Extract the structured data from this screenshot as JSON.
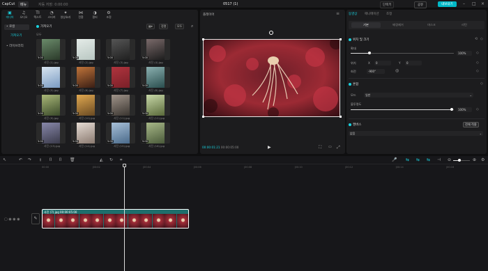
{
  "titlebar": {
    "app_name": "CapCut",
    "menu_label": "메뉴",
    "autosave": "자동 저장: 0:00:00",
    "title": "0517 (1)",
    "shortcut": "단축키",
    "share": "공유",
    "export": "내보내기"
  },
  "media": {
    "tabs": [
      "미디어",
      "오디오",
      "텍스트",
      "스티커",
      "영상효과",
      "전환",
      "필터",
      "조정"
    ],
    "sidebar": {
      "local": "• 로컬",
      "import": "가져오기",
      "library": "• 라이브러리"
    },
    "import_label": "가져오기",
    "all_label": "모두",
    "sort_label": "정렬",
    "filter_label": "모두",
    "files": [
      {
        "badge": "5:00",
        "name": "사진 (1).jpg"
      },
      {
        "badge": "5:00",
        "name": "사진 (2).jpg"
      },
      {
        "badge": "5:00",
        "name": "사진 (3).jpg"
      },
      {
        "badge": "5:00",
        "name": "사진 (4).jpg"
      },
      {
        "badge": "5:00",
        "name": "사진 (5).jpg"
      },
      {
        "badge": "5:00",
        "name": "사진 (6).jpg"
      },
      {
        "badge": "5:00",
        "name": "사진 (7).jpg"
      },
      {
        "badge": "5:00",
        "name": "사진 (8).jpg"
      },
      {
        "badge": "5:00",
        "name": "사진 (9).jpg"
      },
      {
        "badge": "5:00",
        "name": "사진 (10).jpg"
      },
      {
        "badge": "5:00",
        "name": "사진 (11).jpg"
      },
      {
        "badge": "5:00",
        "name": "사진 (12).jpg"
      },
      {
        "badge": "5:00",
        "name": "사진 (13).jpg"
      },
      {
        "badge": "5:00",
        "name": "사진 (14).jpg"
      },
      {
        "badge": "5:00",
        "name": "사진 (15).jpg"
      },
      {
        "badge": "5:00",
        "name": "사진 (16).jpg"
      }
    ]
  },
  "player": {
    "header": "플레이어",
    "current_time": "00:00:01:21",
    "total_time": "00:00:05:00"
  },
  "props": {
    "tabs": [
      "동영상",
      "애니메이션",
      "조정"
    ],
    "subtabs": [
      "기본",
      "배경제거",
      "마스크",
      "리턴"
    ],
    "transform": "위치 및 크기",
    "scale_label": "확대",
    "scale_value": "100%",
    "pos_label": "위치",
    "x_label": "X",
    "x_value": "0",
    "y_label": "Y",
    "y_value": "0",
    "rotate_label": "회전",
    "rotate_value": "-900°",
    "blend": "혼합",
    "mode_label": "모드",
    "mode_value": "일반",
    "opacity_label": "불투명도",
    "opacity_value": "100%",
    "canvas": "캔버스",
    "apply_all": "전체 적용",
    "canvas_value": "없음"
  },
  "timeline": {
    "ticks": [
      "00:00",
      "|00:02",
      "|00:04",
      "|00:06",
      "|00:08",
      "|00:10",
      "|00:12",
      "|00:14",
      "|00:16"
    ],
    "clip_label": "사진 (7).jpg  00:00:05:00",
    "cover_label": "커버"
  }
}
